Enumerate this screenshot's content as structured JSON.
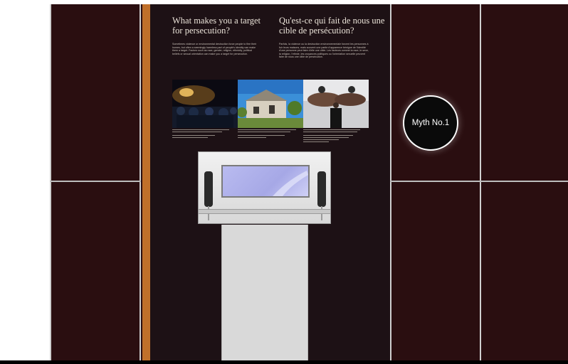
{
  "panel_en": {
    "title": "What makes you a target for persecution?",
    "body": "Sometimes violence or environmental destruction force people to flee their homes, but often a seemingly harmless part of people's identity can make them a target. Factors such as race, gender, religion, ethnicity, political beliefs or sexual orientation can make you a target for persecution."
  },
  "panel_fr": {
    "title": "Qu'est-ce qui fait de nous une cible de persécution?",
    "body": "Parfois, la violence ou la destruction environnementale forcent les personnes à fuir leurs maisons, mais souvent une partie d'apparence bénigne de l'identité d'une personne peut faire d'elle une cible. Les facteurs comme la race, le sexe, la religion, l'ethnie, les croyances politiques ou l'orientation sexuelle peuvent faire de nous une cible de persécution."
  },
  "myth_badge": "Myth No.1",
  "icons": [
    "handset-icon",
    "handset-icon"
  ],
  "colors": {
    "wall": "#2a0e10",
    "stripe": "#c0702a",
    "screen": "#a6a8e6",
    "badge": "#0a0a0a"
  }
}
